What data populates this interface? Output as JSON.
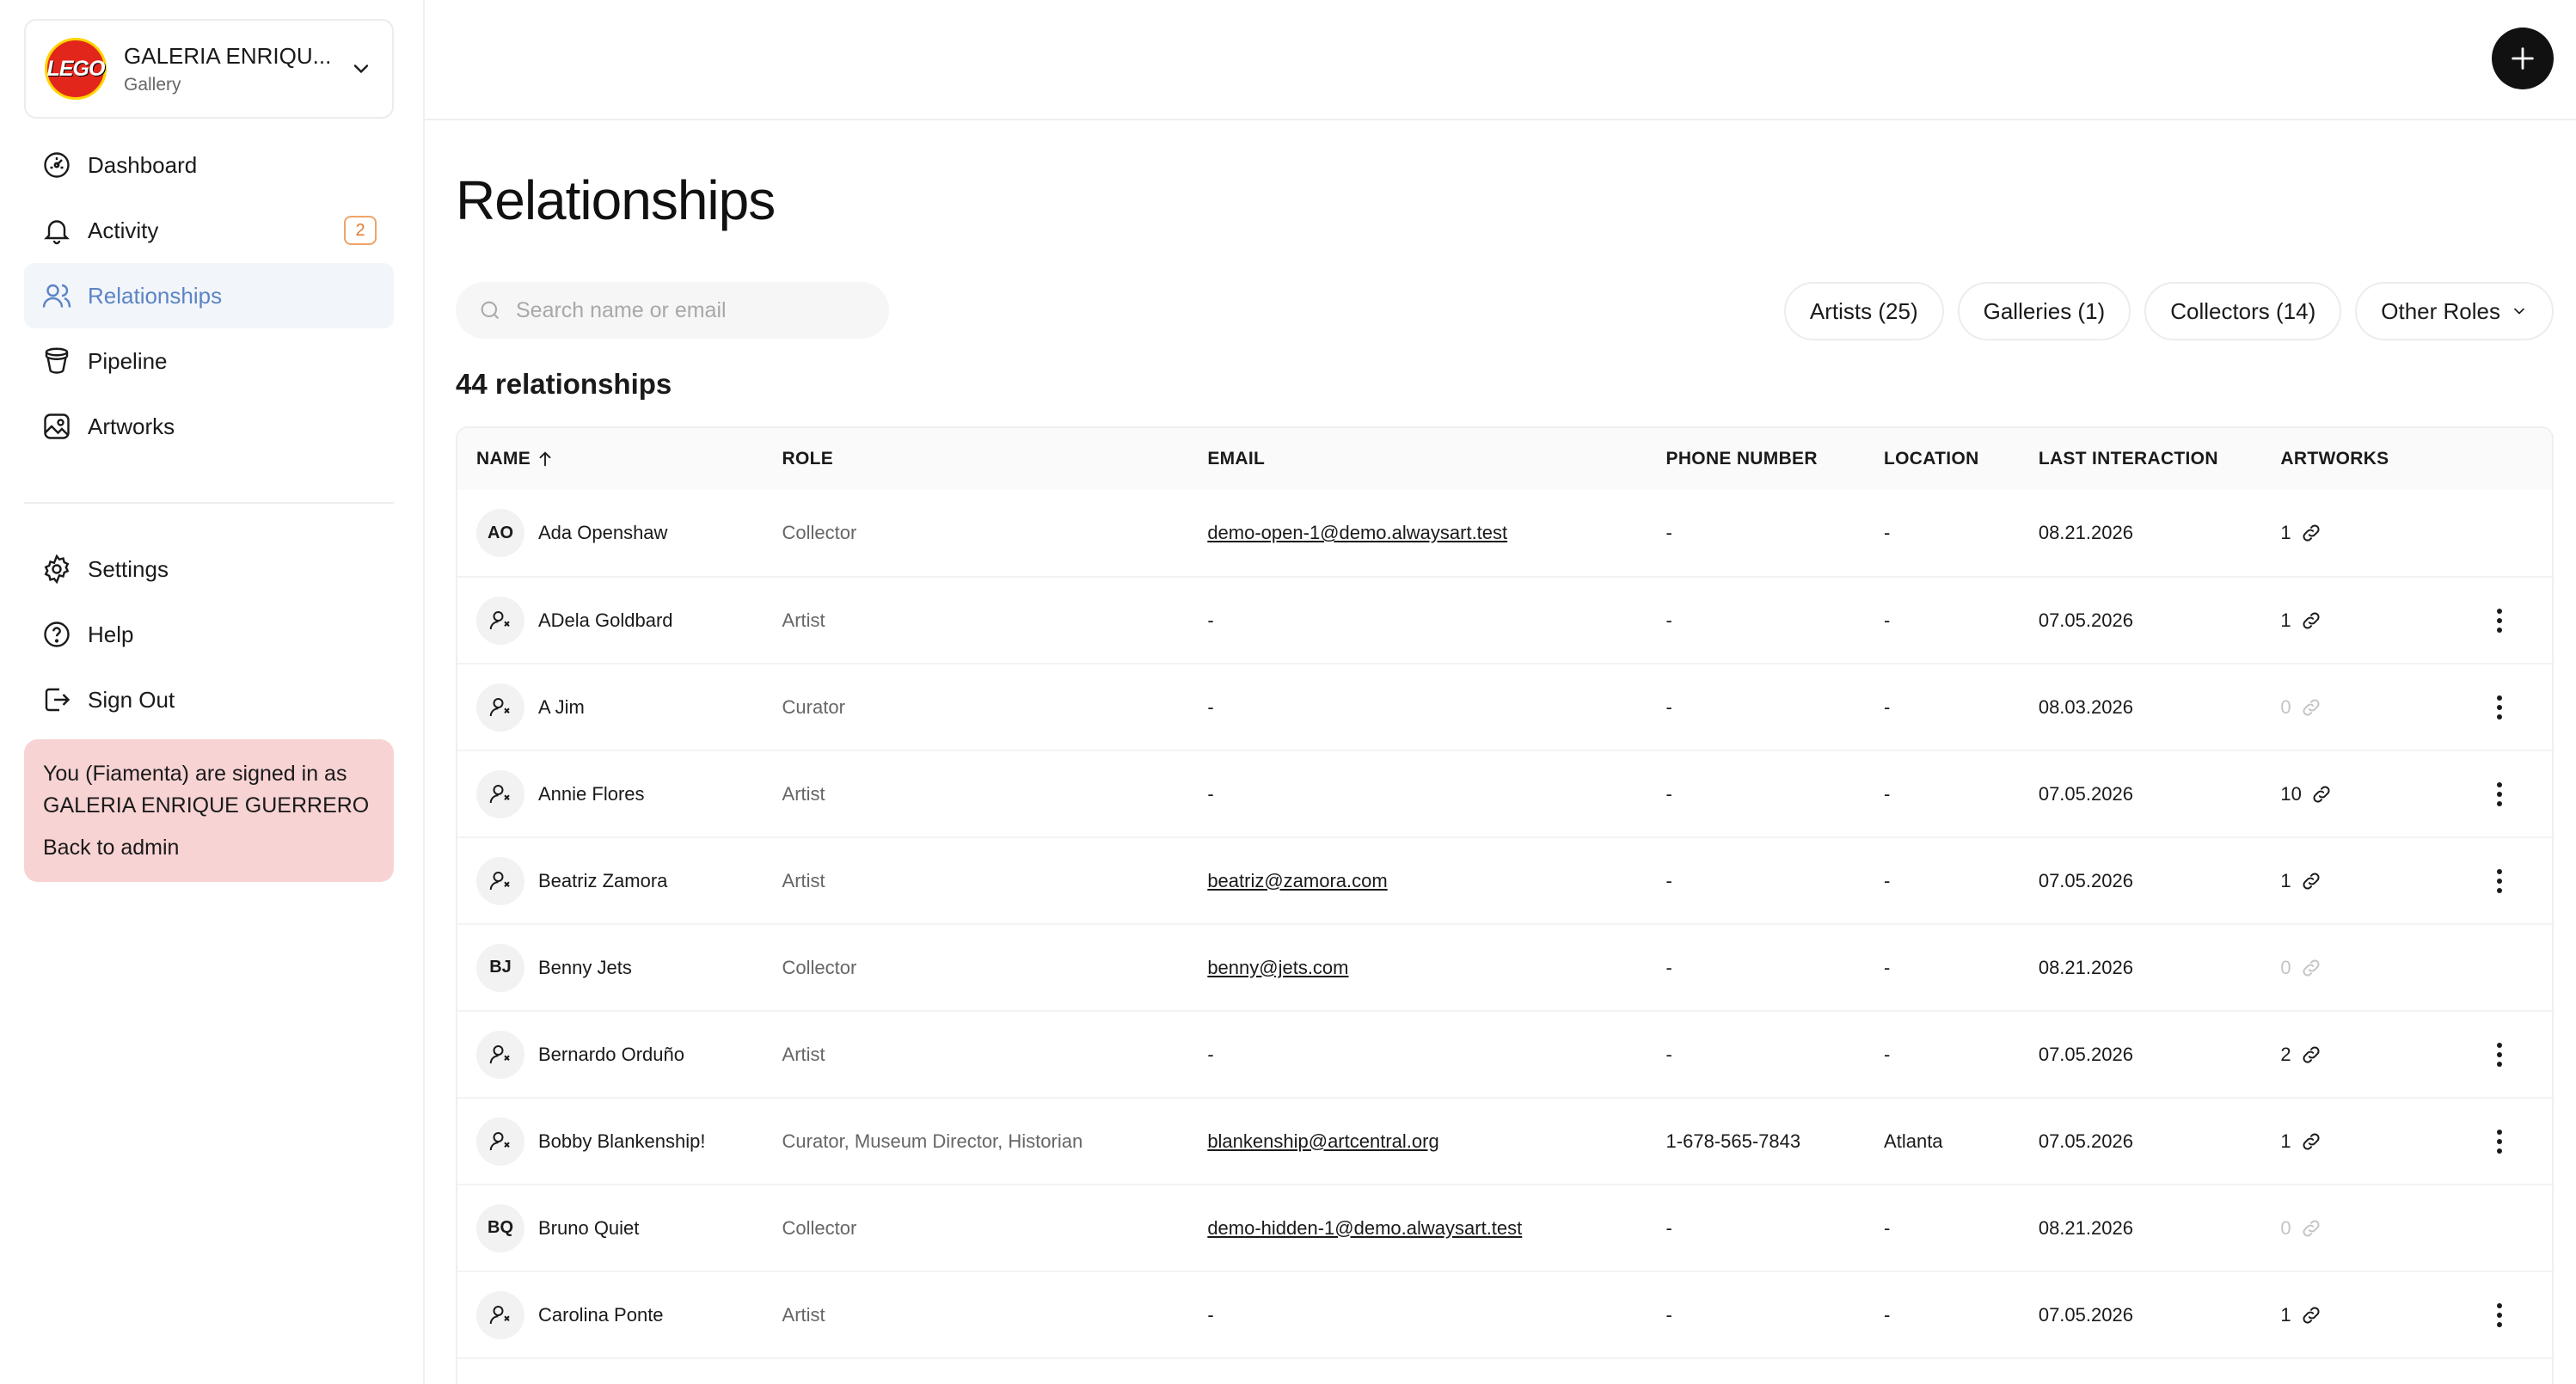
{
  "org": {
    "name": "GALERIA ENRIQU...",
    "type": "Gallery",
    "logo_text": "LEGO"
  },
  "nav": {
    "dashboard": "Dashboard",
    "activity": "Activity",
    "activity_badge": "2",
    "relationships": "Relationships",
    "pipeline": "Pipeline",
    "artworks": "Artworks",
    "settings": "Settings",
    "help": "Help",
    "sign_out": "Sign Out"
  },
  "impersonation": {
    "message": "You (Fiamenta) are signed in as GALERIA ENRIQUE GUERRERO",
    "back": "Back to admin"
  },
  "page": {
    "title": "Relationships",
    "count": "44 relationships"
  },
  "search": {
    "placeholder": "Search name or email"
  },
  "filters": {
    "artists": "Artists (25)",
    "galleries": "Galleries (1)",
    "collectors": "Collectors (14)",
    "other": "Other Roles"
  },
  "table": {
    "headers": {
      "name": "NAME",
      "role": "ROLE",
      "email": "EMAIL",
      "phone": "PHONE NUMBER",
      "location": "LOCATION",
      "last": "LAST INTERACTION",
      "artworks": "ARTWORKS"
    },
    "rows": [
      {
        "initials": "AO",
        "name": "Ada Openshaw",
        "role": "Collector",
        "email": "demo-open-1@demo.alwaysart.test",
        "phone": "-",
        "location": "-",
        "last": "08.21.2026",
        "artworks": "1",
        "menu": false
      },
      {
        "initials": "",
        "name": "ADela Goldbard",
        "role": "Artist",
        "email": "-",
        "phone": "-",
        "location": "-",
        "last": "07.05.2026",
        "artworks": "1",
        "menu": true
      },
      {
        "initials": "",
        "name": "A Jim",
        "role": "Curator",
        "email": "-",
        "phone": "-",
        "location": "-",
        "last": "08.03.2026",
        "artworks": "0",
        "menu": true
      },
      {
        "initials": "",
        "name": "Annie Flores",
        "role": "Artist",
        "email": "-",
        "phone": "-",
        "location": "-",
        "last": "07.05.2026",
        "artworks": "10",
        "menu": true
      },
      {
        "initials": "",
        "name": "Beatriz Zamora",
        "role": "Artist",
        "email": "beatriz@zamora.com",
        "phone": "-",
        "location": "-",
        "last": "07.05.2026",
        "artworks": "1",
        "menu": true
      },
      {
        "initials": "BJ",
        "name": "Benny Jets",
        "role": "Collector",
        "email": "benny@jets.com",
        "phone": "-",
        "location": "-",
        "last": "08.21.2026",
        "artworks": "0",
        "menu": false
      },
      {
        "initials": "",
        "name": "Bernardo Orduño",
        "role": "Artist",
        "email": "-",
        "phone": "-",
        "location": "-",
        "last": "07.05.2026",
        "artworks": "2",
        "menu": true
      },
      {
        "initials": "",
        "name": "Bobby Blankenship!",
        "role": "Curator, Museum Director, Historian",
        "email": "blankenship@artcentral.org",
        "phone": "1-678-565-7843",
        "location": "Atlanta",
        "last": "07.05.2026",
        "artworks": "1",
        "menu": true
      },
      {
        "initials": "BQ",
        "name": "Bruno Quiet",
        "role": "Collector",
        "email": "demo-hidden-1@demo.alwaysart.test",
        "phone": "-",
        "location": "-",
        "last": "08.21.2026",
        "artworks": "0",
        "menu": false
      },
      {
        "initials": "",
        "name": "Carolina Ponte",
        "role": "Artist",
        "email": "-",
        "phone": "-",
        "location": "-",
        "last": "07.05.2026",
        "artworks": "1",
        "menu": true
      }
    ]
  }
}
